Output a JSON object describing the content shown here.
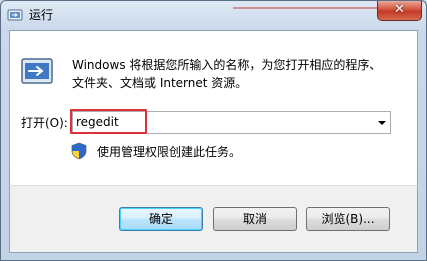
{
  "window": {
    "title": "运行",
    "close_symbol": "✕"
  },
  "content": {
    "description": "Windows 将根据您所输入的名称，为您打开相应的程序、文件夹、文档或 Internet 资源。",
    "open_label": "打开(O):",
    "open_value": "regedit",
    "admin_note": "使用管理权限创建此任务。"
  },
  "buttons": {
    "ok": "确定",
    "cancel": "取消",
    "browse": "浏览(B)..."
  },
  "colors": {
    "highlight_box": "#e0303a",
    "close_button": "#c23a23"
  },
  "icons": {
    "app": "run-icon",
    "dialog": "run-program-icon",
    "admin": "uac-shield-icon",
    "dropdown": "chevron-down-icon"
  }
}
